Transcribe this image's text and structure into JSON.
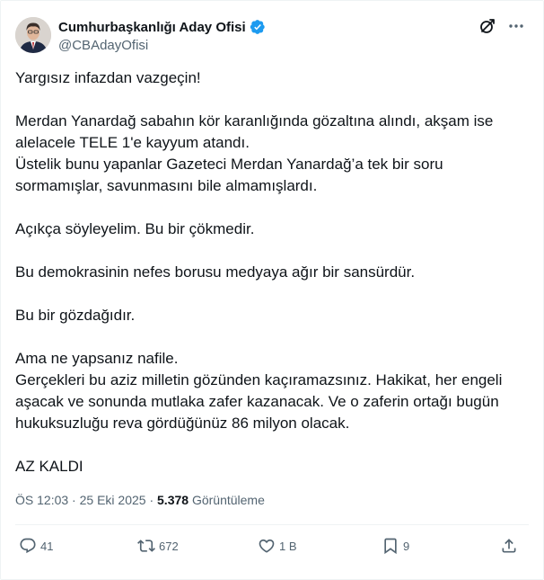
{
  "author": {
    "display_name": "Cumhurbaşkanlığı Aday Ofisi",
    "handle": "@CBAdayOfisi",
    "verified": true,
    "verified_color": "#1d9bf0"
  },
  "tweet": {
    "paragraphs": [
      [
        "Yargısız infazdan vazgeçin!"
      ],
      [
        "Merdan Yanardağ sabahın kör karanlığında gözaltına alındı, akşam ise",
        "alelacele TELE 1'e kayyum atandı.",
        "Üstelik bunu yapanlar Gazeteci Merdan Yanardağ’a tek bir soru",
        "sormamışlar, savunmasını bile almamışlardı."
      ],
      [
        "Açıkça söyleyelim. Bu bir çökmedir."
      ],
      [
        "Bu demokrasinin nefes borusu medyaya ağır bir sansürdür."
      ],
      [
        "Bu bir gözdağıdır."
      ],
      [
        "Ama ne yapsanız nafile.",
        "Gerçekleri bu aziz milletin gözünden kaçıramazsınız.  Hakikat, her engeli",
        "aşacak ve sonunda mutlaka zafer kazanacak. Ve o zaferin ortağı bugün",
        "hukuksuzluğu reva gördüğünüz 86 milyon olacak."
      ],
      [
        "AZ KALDI"
      ]
    ]
  },
  "meta": {
    "time": "ÖS 12:03",
    "separator": "·",
    "date": "25 Eki 2025",
    "views_count": "5.378",
    "views_label": "Görüntüleme"
  },
  "actions": {
    "replies": "41",
    "retweets": "672",
    "likes": "1 B",
    "bookmarks": "9"
  },
  "icons": {
    "verified": "verified-badge-icon",
    "grok": "grok-icon",
    "more": "more-dots-icon",
    "reply": "reply-icon",
    "retweet": "retweet-icon",
    "like": "heart-icon",
    "bookmark": "bookmark-icon",
    "share": "share-icon"
  },
  "colors": {
    "text": "#0f1419",
    "secondary": "#536471",
    "divider": "#eff3f4"
  }
}
